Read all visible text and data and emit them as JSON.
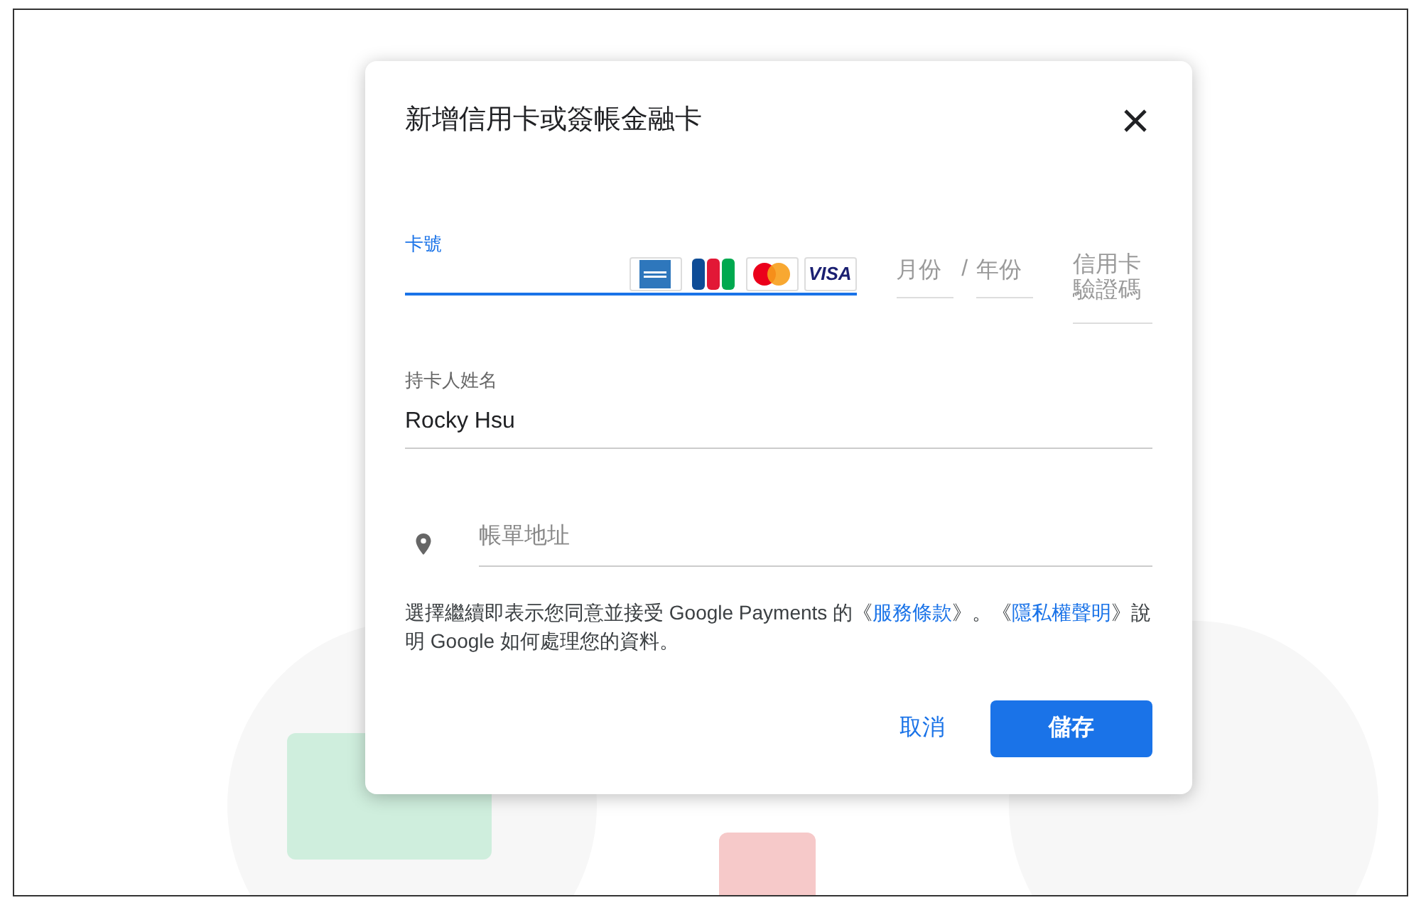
{
  "dialog": {
    "title": "新增信用卡或簽帳金融卡",
    "card_number": {
      "label": "卡號",
      "focused": true
    },
    "card_logos": [
      {
        "kind": "amex"
      },
      {
        "kind": "jcb"
      },
      {
        "kind": "mastercard"
      },
      {
        "kind": "visa",
        "text": "VISA"
      }
    ],
    "month": {
      "placeholder": "月份"
    },
    "separator": "/",
    "year": {
      "placeholder": "年份"
    },
    "cvc": {
      "placeholder": "信用卡驗證碼"
    },
    "cardholder": {
      "label": "持卡人姓名",
      "value": "Rocky Hsu"
    },
    "address": {
      "placeholder": "帳單地址"
    },
    "terms": [
      {
        "text": "選擇繼續即表示您同意並接受 Google Payments 的《",
        "link": false
      },
      {
        "text": "服務條款",
        "link": true
      },
      {
        "text": "》。《",
        "link": false
      },
      {
        "text": "隱私權聲明",
        "link": true
      },
      {
        "text": "》說明 Google 如何處理您的資料。",
        "link": false
      }
    ],
    "buttons": [
      {
        "label": "取消",
        "kind": "text"
      },
      {
        "label": "儲存",
        "kind": "primary"
      }
    ]
  }
}
